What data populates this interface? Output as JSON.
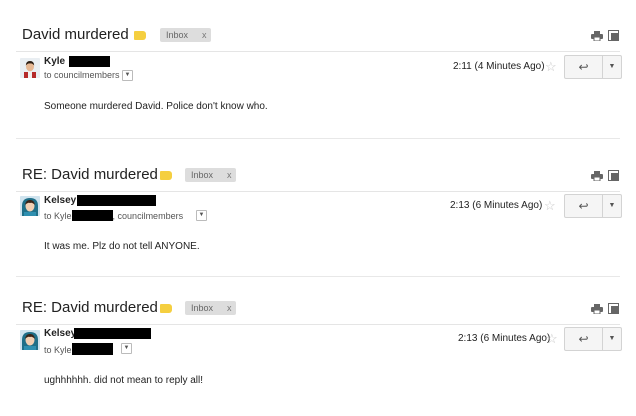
{
  "messages": [
    {
      "subject": "David murdered",
      "label": "Inbox",
      "label_close": "x",
      "sender": "Kyle",
      "recipients_prefix": "to councilmembers",
      "recipients_name": "",
      "recipients_suffix": "",
      "time": "2:11 (4 Minutes Ago)",
      "body": "Someone murdered David. Police don't know who.",
      "avatar": "kyle-avatar"
    },
    {
      "subject": "RE: David murdered",
      "label": "Inbox",
      "label_close": "x",
      "sender": "Kelsey",
      "recipients_prefix": "to",
      "recipients_name": "Kyle",
      "recipients_suffix": ", councilmembers",
      "time": "2:13 (6 Minutes Ago)",
      "body": "It was me. Plz do not tell ANYONE.",
      "avatar": "kelsey-avatar"
    },
    {
      "subject": "RE: David murdered",
      "label": "Inbox",
      "label_close": "x",
      "sender": "Kelsey",
      "recipients_prefix": "to",
      "recipients_name": "Kyle",
      "recipients_suffix": "",
      "time": "2:13 (6 Minutes Ago)",
      "body": "ughhhhhh. did not mean to reply all!",
      "avatar": "kelsey-avatar"
    }
  ],
  "icons": {
    "reply": "reply-icon",
    "more": "chevron-down-icon",
    "star": "star-icon",
    "print": "print-icon",
    "popout": "new-window-icon"
  },
  "colors": {
    "label_tag": "#f5cf40",
    "chip_bg": "#dddddd",
    "redaction": "#000000"
  }
}
